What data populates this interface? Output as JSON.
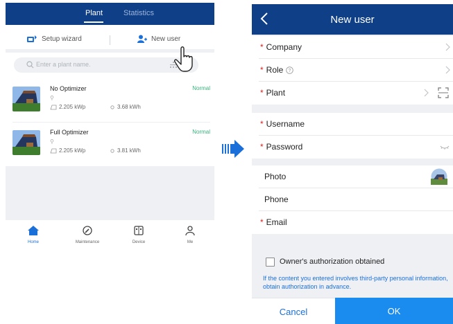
{
  "left": {
    "tabs": [
      {
        "label": "Plant",
        "active": true
      },
      {
        "label": "Statistics",
        "active": false
      }
    ],
    "actions": {
      "setup_wizard": "Setup wizard",
      "new_user": "New user"
    },
    "search": {
      "placeholder": "Enter a plant name."
    },
    "plants": [
      {
        "name": "No Optimizer",
        "status": "Normal",
        "capacity": "2.205 kWp",
        "energy": "3.68 kWh"
      },
      {
        "name": "Full Optimizer",
        "status": "Normal",
        "capacity": "2.205 kWp",
        "energy": "3.81 kWh"
      }
    ],
    "nav": [
      {
        "label": "Home",
        "icon": "home-icon",
        "active": true
      },
      {
        "label": "Maintenance",
        "icon": "wrench-icon",
        "active": false
      },
      {
        "label": "Device",
        "icon": "device-icon",
        "active": false
      },
      {
        "label": "Me",
        "icon": "person-icon",
        "active": false
      }
    ],
    "colors": {
      "header": "#0f3f87",
      "status_normal": "#36b37e",
      "active": "#1a6fd9"
    }
  },
  "right": {
    "title": "New user",
    "fields": {
      "company": {
        "label": "Company",
        "required": "*"
      },
      "role": {
        "label": "Role",
        "required": "*"
      },
      "plant": {
        "label": "Plant",
        "required": "*"
      },
      "username": {
        "label": "Username",
        "required": "*"
      },
      "password": {
        "label": "Password",
        "required": "*"
      },
      "photo": {
        "label": "Photo"
      },
      "phone": {
        "label": "Phone"
      },
      "email": {
        "label": "Email",
        "required": "*"
      }
    },
    "consent": {
      "checkbox_label": "Owner's authorization obtained",
      "note": "If the content you entered involves third-party personal information, obtain authorization in advance."
    },
    "buttons": {
      "cancel": "Cancel",
      "ok": "OK"
    },
    "colors": {
      "header": "#0f3f87",
      "ok": "#1a8cf0",
      "required": "#e02020",
      "link": "#1a6fd9"
    }
  }
}
